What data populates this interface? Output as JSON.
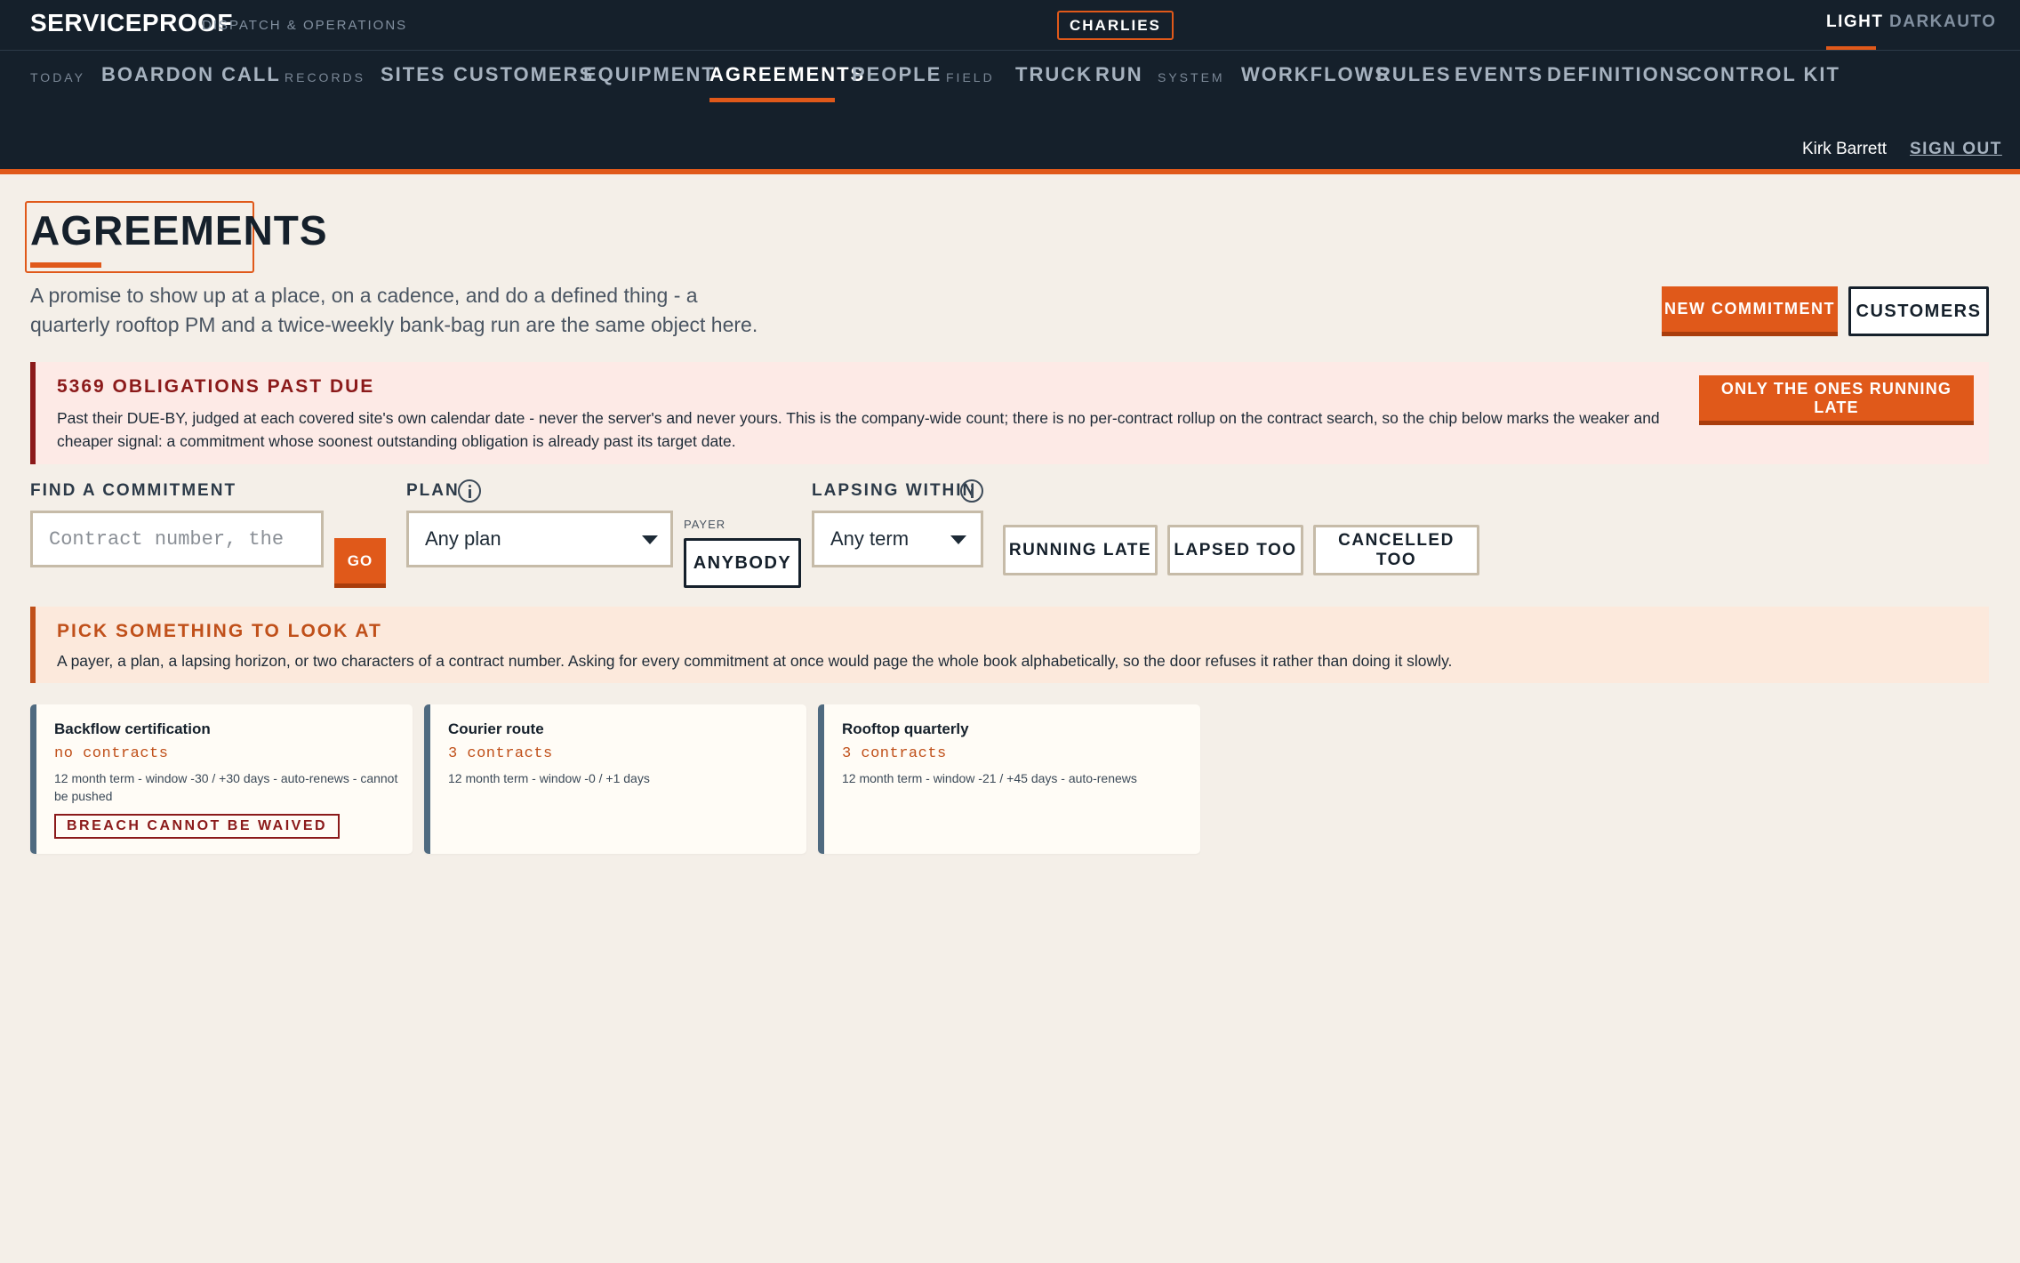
{
  "app": {
    "brand": "SERVICEPROOF",
    "subtitle": "DISPATCH & OPERATIONS",
    "tenant": "CHARLIES",
    "themes": [
      "LIGHT",
      "DARK",
      "AUTO"
    ]
  },
  "nav": {
    "groups": {
      "today": "TODAY",
      "records": "RECORDS",
      "field": "FIELD",
      "system": "SYSTEM"
    },
    "items": {
      "board": "BOARD",
      "on_call": "ON CALL",
      "sites": "SITES",
      "customers": "CUSTOMERS",
      "equipment": "EQUIPMENT",
      "agreements": "AGREEMENTS",
      "people": "PEOPLE",
      "truck": "TRUCK",
      "run": "RUN",
      "workflows": "WORKFLOWS",
      "rules": "RULES",
      "events": "EVENTS",
      "definitions": "DEFINITIONS",
      "control_kit": "CONTROL KIT"
    },
    "active": "AGREEMENTS"
  },
  "user": {
    "name": "Kirk Barrett",
    "sign_out": "SIGN OUT"
  },
  "page": {
    "title": "AGREEMENTS",
    "intro_line1": "A promise to show up at a place, on a cadence, and do a defined thing - a",
    "intro_line2": "quarterly rooftop PM and a twice-weekly bank-bag run are the same object here.",
    "new_commitment": "NEW COMMITMENT",
    "customers": "CUSTOMERS"
  },
  "alert": {
    "title": "5369 OBLIGATIONS PAST DUE",
    "text": "Past their DUE-BY, judged at each covered site's own calendar date - never the server's and never yours. This is the company-wide count; there is no per-contract rollup on the contract search, so the chip below marks the weaker and cheaper signal: a commitment whose soonest outstanding obligation is already past its target date.",
    "action": "ONLY THE ONES RUNNING LATE",
    "color": "#8b1a1a"
  },
  "filters": {
    "find_label": "FIND A COMMITMENT",
    "find_placeholder": "Contract number, the",
    "go": "GO",
    "plan_label": "PLAN",
    "plan_value": "Any plan",
    "payer_label": "PAYER",
    "payer_value": "ANYBODY",
    "lapsing_label": "LAPSING WITHIN",
    "lapsing_value": "Any term",
    "chips": [
      "RUNNING LATE",
      "LAPSED TOO",
      "CANCELLED TOO"
    ]
  },
  "notice": {
    "title": "PICK SOMETHING TO LOOK AT",
    "text": "A payer, a plan, a lapsing horizon, or two characters of a contract number. Asking for every commitment at once would page the whole book alphabetically, so the door refuses it rather than doing it slowly."
  },
  "plans": [
    {
      "title": "Backflow certification",
      "count": "no contracts",
      "meta": "12 month term - window -30 / +30 days - auto-renews - cannot be pushed",
      "badge": "BREACH CANNOT BE WAIVED"
    },
    {
      "title": "Courier route",
      "count": "3 contracts",
      "meta": "12 month term - window -0 / +1 days",
      "badge": ""
    },
    {
      "title": "Rooftop quarterly",
      "count": "3 contracts",
      "meta": "12 month term - window -21 / +45 days - auto-renews",
      "badge": ""
    }
  ],
  "colors": {
    "accent": "#e0591a",
    "header_bg": "#15202b",
    "page_bg": "#f4efe8"
  }
}
